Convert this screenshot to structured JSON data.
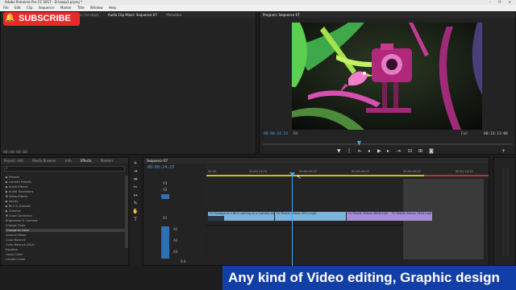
{
  "window": {
    "title": "Adobe Premiere Pro CC 2017 - D:\\sequ1.prproj *",
    "controls": "–  ❐  ✕"
  },
  "menu": [
    "File",
    "Edit",
    "Clip",
    "Sequence",
    "Marker",
    "Title",
    "Window",
    "Help"
  ],
  "subscribe": {
    "label": "SUBSCRIBE",
    "icon": "bell-icon"
  },
  "source_panel": {
    "tabs": [
      "Effect Controls",
      "Lumetri Scopes",
      "Source: (no clips)",
      "Audio Clip Mixer: Sequence 67",
      "Metadata"
    ],
    "timecode": "00:00:00:00"
  },
  "program_panel": {
    "title": "Program: Sequence 67",
    "timecode": "00:00:24:23",
    "fit": "Fit",
    "resolution": "Full",
    "duration": "00:23:13:08"
  },
  "effects_panel": {
    "tabs": [
      "Project: edit",
      "Media Browser",
      "Info",
      "Effects",
      "Markers"
    ],
    "active_tab": "Effects",
    "items": [
      {
        "label": "▶ Presets"
      },
      {
        "label": "▶ Lumetri Presets"
      },
      {
        "label": "▶ Audio Effects"
      },
      {
        "label": "▶ Audio Transitions"
      },
      {
        "label": "▼ Video Effects"
      },
      {
        "label": "   ▶ Adjust"
      },
      {
        "label": "   ▶ Blur & Sharpen"
      },
      {
        "label": "   ▶ Channel"
      },
      {
        "label": "   ▼ Color Correction"
      },
      {
        "label": "        Brightness & Contrast"
      },
      {
        "label": "        Change Color"
      },
      {
        "label": "        Change to Color",
        "selected": true
      },
      {
        "label": "        Channel Mixer"
      },
      {
        "label": "        Color Balance"
      },
      {
        "label": "        Color Balance (HLS)"
      },
      {
        "label": "        Equalize"
      },
      {
        "label": "        Leave Color"
      },
      {
        "label": "        Lumetri Color"
      }
    ]
  },
  "timeline": {
    "sequence_tab": "Sequence 67",
    "timecode": "00:00:24:23",
    "ruler": [
      "00:00",
      "00:00:14:23",
      "00:00:29:23",
      "00:00:44:22",
      "00:00:59:22",
      "00:01:14:22"
    ],
    "tracks": {
      "video": [
        "V3",
        "V2",
        "V1"
      ],
      "audio": [
        "A1",
        "A2",
        "A3"
      ],
      "master": "0.0"
    },
    "clips": [
      {
        "label": "Fx  Footage of a Bird Looking at a Camera.mp4 [V]"
      },
      {
        "label": "Fx  Pexels Videos 3011.mp4"
      },
      {
        "label": "Fx  Pexels Videos 4626.mp4"
      },
      {
        "label": "Fx  Pexels Videos 2346.mp4"
      }
    ]
  },
  "banner": {
    "text": "Any kind of Video editing, Graphic design"
  }
}
